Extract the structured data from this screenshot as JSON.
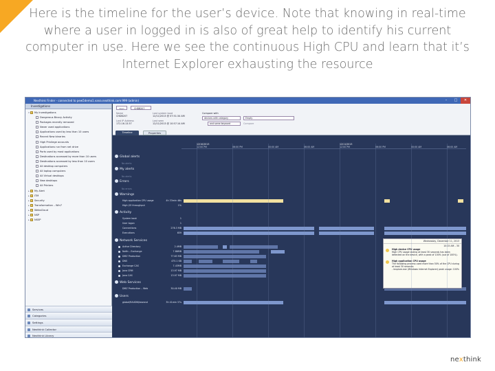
{
  "caption": "Here is the timeline for the user’s device. Note that knowing in real-time where a user in logged in is also of great help to identify his current computer in use. Here we see the continuous High CPU and learn that it’s Internet Explorer exhausting the resource",
  "brand": {
    "pre": "ne",
    "x": "x",
    "post": "think"
  },
  "window": {
    "title": "Nexthink Finder - connected to pew5demo1.vana.nexthink.com:999 (admin)",
    "min": "–",
    "max": "□",
    "close": "✕"
  },
  "sidebar": {
    "header": "Investigations",
    "items": [
      {
        "label": "My Investigations",
        "type": "folder",
        "level": 0
      },
      {
        "label": "Dangerous Binary Activity",
        "type": "doc",
        "level": 1
      },
      {
        "label": "Packages recently removed",
        "type": "doc",
        "level": 1
      },
      {
        "label": "Never used applications",
        "type": "doc",
        "level": 1
      },
      {
        "label": "Applications used by less than 10 users",
        "type": "doc",
        "level": 1
      },
      {
        "label": "Recent New binaries",
        "type": "doc",
        "level": 1
      },
      {
        "label": "High Privilege accounts",
        "type": "doc",
        "level": 1
      },
      {
        "label": "Applications run from net drive",
        "type": "doc",
        "level": 1
      },
      {
        "label": "Ports used by most applications",
        "type": "doc",
        "level": 1
      },
      {
        "label": "Destinations accessed by more than 10 users",
        "type": "doc",
        "level": 1
      },
      {
        "label": "Destinations accessed by less than 10 users",
        "type": "doc",
        "level": 1
      },
      {
        "label": "All desktop computers",
        "type": "doc",
        "level": 1
      },
      {
        "label": "All laptop computers",
        "type": "doc",
        "level": 1
      },
      {
        "label": "All Virtual desktops",
        "type": "doc",
        "level": 1
      },
      {
        "label": "New desktops",
        "type": "doc",
        "level": 1
      },
      {
        "label": "All Printers",
        "type": "doc",
        "level": 1
      },
      {
        "label": "My Alert",
        "type": "folder",
        "level": 0
      },
      {
        "label": "ITM",
        "type": "folder",
        "level": 0
      },
      {
        "label": "Security",
        "type": "folder",
        "level": 0
      },
      {
        "label": "Transformation – Win7",
        "type": "folder",
        "level": 0
      },
      {
        "label": "WebsCloud",
        "type": "folder",
        "level": 0
      },
      {
        "label": "NSP",
        "type": "folder",
        "level": 0
      },
      {
        "label": "NSSP",
        "type": "folder",
        "level": 0
      }
    ],
    "bottom": [
      "Services",
      "Categories",
      "Settings",
      "Nexthink Collector",
      "Nexthink Library"
    ]
  },
  "header": {
    "search": "Start",
    "tab": "CHDB207",
    "name_label": "Name",
    "name": "CHDB207",
    "last_boot_label": "Last system boot",
    "last_boot": "12/11/2013 @ 07:51:34 AM",
    "ip_label": "Last IP Address",
    "ip": "172.16.13.57",
    "last_seen_label": "Last seen",
    "last_seen": "12/11/2013 @ 10:57:14 AM",
    "compare_label": "Compare with",
    "compare_select": "devices with category",
    "compare_value": "Empty",
    "compare_sub": "and same keyword",
    "compare_btn": "Compare",
    "tab_timeline": "Timeline",
    "tab_props": "Properties"
  },
  "ruler": {
    "ticks": [
      {
        "label": "12:00 PM"
      },
      {
        "label": "06:00 PM"
      },
      {
        "label": "00:00 AM"
      },
      {
        "label": "06:00 AM"
      },
      {
        "label": "12:00 PM"
      },
      {
        "label": "06:00 PM"
      },
      {
        "label": "00:00 AM"
      },
      {
        "label": "06:00 AM"
      }
    ],
    "day1": "12/10/2013",
    "day2": "12/11/2013"
  },
  "sections": {
    "global": "Global alerts",
    "my": "My alerts",
    "errors": "Errors",
    "warnings": "Warnings",
    "activity": "Activity",
    "network": "Network Services",
    "web": "Web Services",
    "users": "Users",
    "none_global": "No alerts",
    "none_my": "No alerts",
    "none_errors": "No errors"
  },
  "warnings": [
    {
      "label": "High application CPU usage",
      "value": "4h 33min 46s"
    },
    {
      "label": "High I/O throughput",
      "value": "1%"
    }
  ],
  "activity": [
    {
      "label": "System boot",
      "value": "1"
    },
    {
      "label": "User logon",
      "value": "1"
    },
    {
      "label": "Connections",
      "value": "276.3 MB"
    },
    {
      "label": "Executions",
      "value": "659"
    }
  ],
  "network": [
    {
      "label": "Active Directory",
      "value": "2.4MB"
    },
    {
      "label": "Nofin – Exchange",
      "value": "7.86MB"
    },
    {
      "label": "DMZ Production",
      "value": "77.63 MB"
    },
    {
      "label": "DNS",
      "value": "475.1 KB"
    },
    {
      "label": "Exchange CAS",
      "value": "7.43MB"
    },
    {
      "label": "Java CRM",
      "value": "13.97 MB"
    },
    {
      "label": "Java CAS",
      "value": "13.97 MB"
    }
  ],
  "web": [
    {
      "label": "DMZ Production – Web",
      "value": "30.40 MB"
    }
  ],
  "users": [
    {
      "label": "global\\RAUDN\\kewand",
      "value": "3h 41min 57s"
    }
  ],
  "popup": {
    "date": "Wednesday, December 11, 2013",
    "time": "10:15 AM – 30",
    "t1_title": "High device CPU usage",
    "t1_body": "High CPU usage lasting at least 30 seconds has been detected on the device, with a peak of 100% (out of 100%).",
    "t2_title": "High application CPU usage",
    "t2_body": "The following process used more than 50% of the CPU during at least 30 seconds:",
    "t2_item": "- iexplore.exe (Windows Internet Explorer) peak usage: 100%"
  }
}
